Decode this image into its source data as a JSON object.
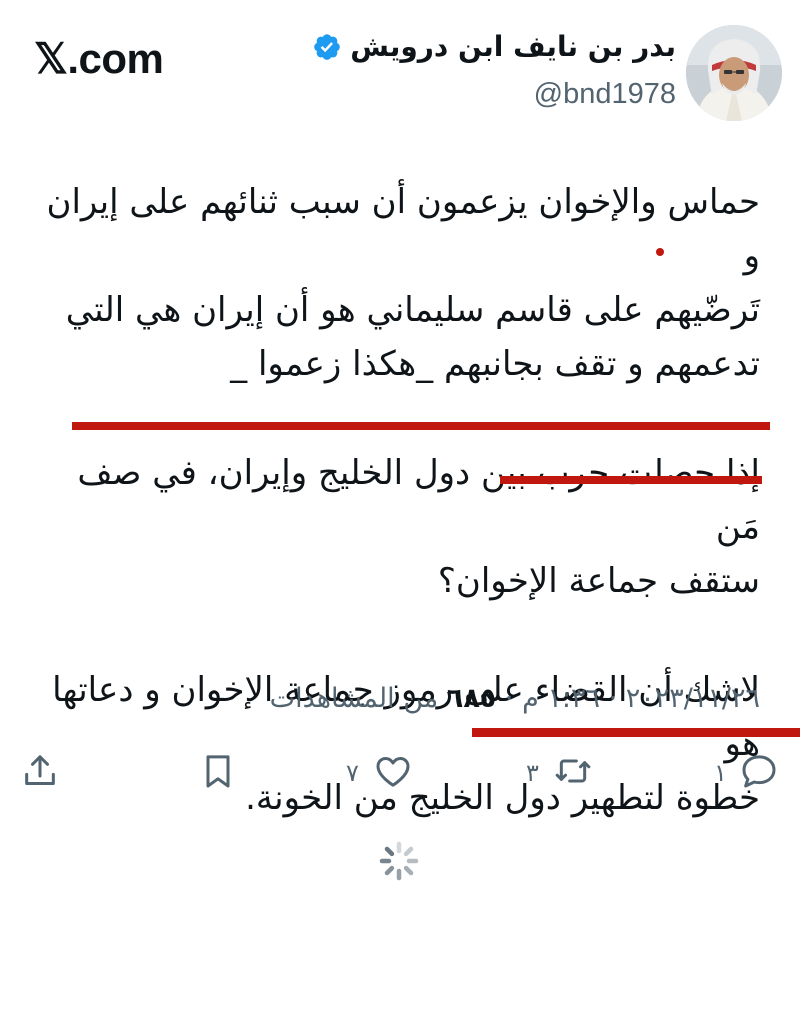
{
  "header": {
    "logo_text": "𝕏.com",
    "display_name": "بدر بن نايف ابن درويش",
    "handle": "@bnd1978",
    "verified": true,
    "verified_color": "#1d9bf0"
  },
  "tweet": {
    "paragraph_1": "حماس والإخوان يزعمون أن سبب ثنائهم على إيران و\nتَرضّيهم على قاسم سليماني هو أن إيران هي التي\nتدعمهم و تقف بجانبهم _هكذا زعموا _",
    "paragraph_2": "إذا حصلت حرب بين دول الخليج وإيران، في صف مَن\nستقف جماعة الإخوان؟",
    "paragraph_3": "لاشك أن القضاء على رموز جماعة الإخوان و دعاتها هو\nخطوة لتطهير دول الخليج من الخونة."
  },
  "meta": {
    "time": "١:٣٦ م",
    "separator": "·",
    "date": "٢٠٢٣/١١/٢٦",
    "views_count": "٦٨٥",
    "views_label": "من المشاهدات"
  },
  "actions": {
    "replies": "١",
    "reposts": "٣",
    "likes": "٧"
  },
  "colors": {
    "underline_marker": "#c0180f",
    "secondary_text": "#536471",
    "primary_text": "#0f1419"
  }
}
